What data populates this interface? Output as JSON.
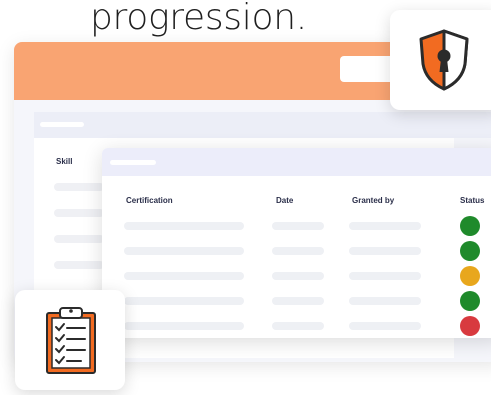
{
  "headline": "progression.",
  "skills_panel": {
    "column_label": "Skill"
  },
  "certifications_table": {
    "headers": {
      "certification": "Certification",
      "date": "Date",
      "granted_by": "Granted by",
      "status": "Status"
    },
    "rows": [
      {
        "status_color": "#1f8a2b"
      },
      {
        "status_color": "#1f8a2b"
      },
      {
        "status_color": "#e8a71d"
      },
      {
        "status_color": "#1f8a2b"
      },
      {
        "status_color": "#d83a3f"
      }
    ]
  },
  "icons": {
    "shield": "shield-keyhole-icon",
    "clipboard": "clipboard-checklist-icon"
  },
  "colors": {
    "accent": "#f9a472",
    "icon_orange": "#f26b21",
    "status_green": "#1f8a2b",
    "status_yellow": "#e8a71d",
    "status_red": "#d83a3f"
  }
}
